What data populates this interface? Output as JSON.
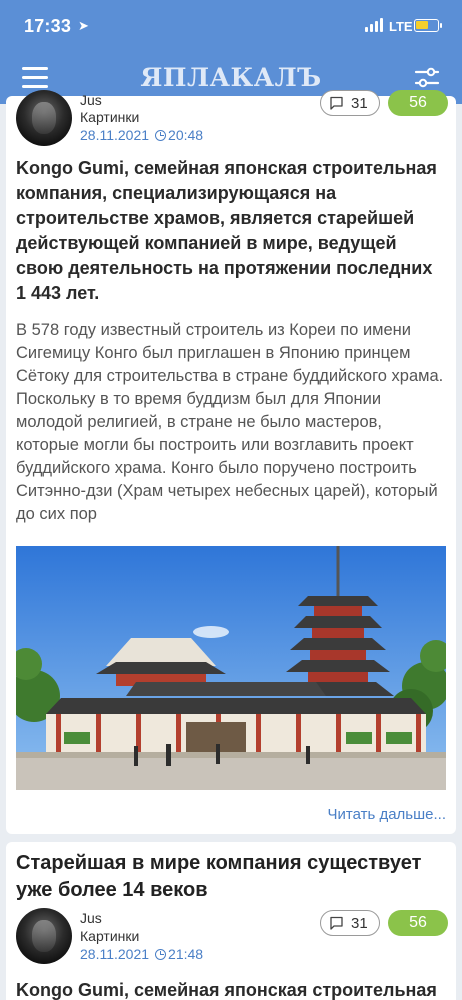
{
  "status": {
    "time": "17:33",
    "network": "LTE"
  },
  "header": {
    "logo": "ЯПЛАКАЛЪ"
  },
  "post1": {
    "author": "Jus",
    "category": "Картинки",
    "date": "28.11.2021",
    "time": "20:48",
    "comments": "31",
    "rating": "56",
    "lead": "Kongo Gumi, семейная японская строительная компания, специализирующаяся на строительстве храмов, является старейшей действующей компанией в мире, ведущей свою деятельность на протяжении последних 1 443 лет.",
    "body": "В 578 году известный строитель из Кореи по имени Сигемицу Конго был приглашен в Японию принцем Сётоку для строительства в стране буддийского храма. Поскольку в то время буддизм был для Японии молодой религией, в стране не было мастеров, которые могли бы построить или возглавить проект буддийского храма. Конго было поручено построить Ситэнно-дзи (Храм четырех небесных царей), который до сих пор",
    "read_more": "Читать дальше..."
  },
  "post2": {
    "title": "Старейшая в мире компания существует уже более 14 веков",
    "author": "Jus",
    "category": "Картинки",
    "date": "28.11.2021",
    "time": "21:48",
    "comments": "31",
    "rating": "56",
    "lead": "Kongo Gumi, семейная японская строительная"
  },
  "icons": [
    "menu-icon",
    "filter-icon",
    "location-arrow-icon",
    "clock-icon",
    "comment-icon"
  ],
  "colors": {
    "header": "#5b8fd6",
    "accent": "#4a7fc6",
    "rating": "#8bc34a",
    "battery": "#f5cf2b"
  }
}
